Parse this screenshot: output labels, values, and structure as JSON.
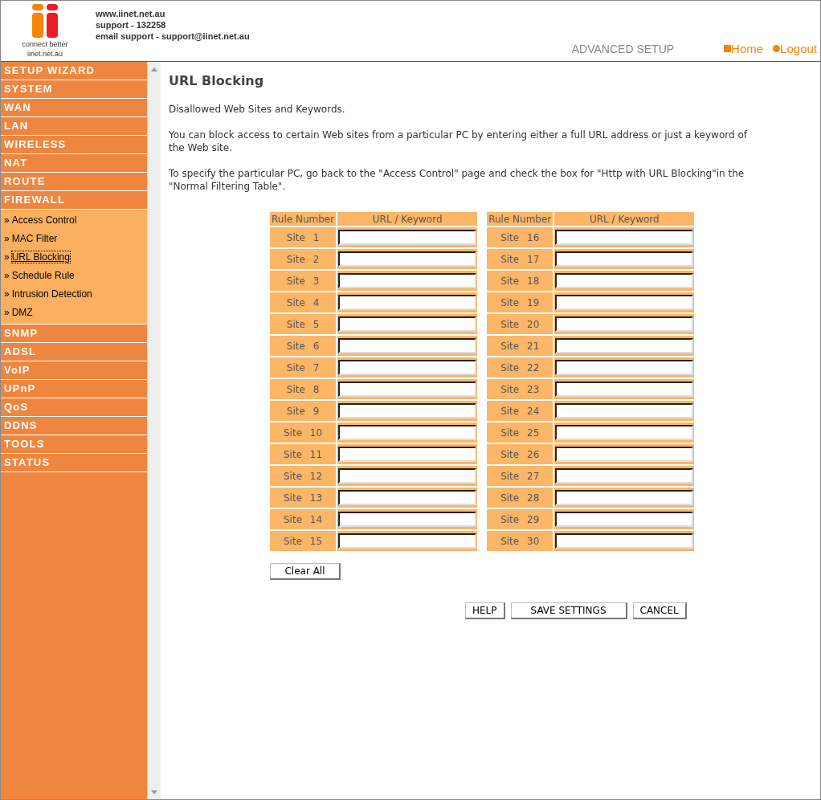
{
  "header": {
    "logo_tagline": "connect better",
    "logo_domain": "iinet.net.au",
    "contact_lines": [
      "www.iinet.net.au",
      "support - 132258",
      "email support - support@iinet.net.au"
    ],
    "section_title": "ADVANCED SETUP",
    "links": [
      {
        "label": "Home",
        "kind": "square"
      },
      {
        "label": "Logout",
        "kind": "dot"
      }
    ]
  },
  "sidebar": {
    "items": [
      {
        "label": "SETUP WIZARD"
      },
      {
        "label": "SYSTEM"
      },
      {
        "label": "WAN"
      },
      {
        "label": "LAN"
      },
      {
        "label": "WIRELESS"
      },
      {
        "label": "NAT"
      },
      {
        "label": "ROUTE"
      },
      {
        "label": "FIREWALL",
        "children": [
          {
            "bullet": "»",
            "label": "Access Control",
            "selected": false
          },
          {
            "bullet": "»",
            "label": "MAC Filter",
            "selected": false
          },
          {
            "bullet": "»",
            "label": "URL Blocking",
            "selected": true
          },
          {
            "bullet": "»",
            "label": "Schedule Rule",
            "selected": false
          },
          {
            "bullet": "»",
            "label": "Intrusion Detection",
            "selected": false
          },
          {
            "bullet": "»",
            "label": "DMZ",
            "selected": false
          }
        ]
      },
      {
        "label": "SNMP"
      },
      {
        "label": "ADSL"
      },
      {
        "label": "VoIP"
      },
      {
        "label": "UPnP"
      },
      {
        "label": "QoS"
      },
      {
        "label": "DDNS"
      },
      {
        "label": "TOOLS"
      },
      {
        "label": "STATUS"
      }
    ]
  },
  "page": {
    "title": "URL Blocking",
    "paragraphs": [
      "Disallowed Web Sites and Keywords.",
      "You can block access to certain Web sites from a particular PC by entering either a full URL address or just a keyword of the Web site.",
      "To specify the particular PC, go back to the \"Access Control\" page and check the box for \"Http with URL Blocking\"in the \"Normal Filtering Table\"."
    ]
  },
  "tables": [
    {
      "columns": [
        "Rule Number",
        "URL / Keyword"
      ],
      "rows": [
        "Site 1",
        "Site 2",
        "Site 3",
        "Site 4",
        "Site 5",
        "Site 6",
        "Site 7",
        "Site 8",
        "Site 9",
        "Site 10",
        "Site 11",
        "Site 12",
        "Site 13",
        "Site 14",
        "Site 15"
      ]
    },
    {
      "columns": [
        "Rule Number",
        "URL / Keyword"
      ],
      "rows": [
        "Site 16",
        "Site 17",
        "Site 18",
        "Site 19",
        "Site 20",
        "Site 21",
        "Site 22",
        "Site 23",
        "Site 24",
        "Site 25",
        "Site 26",
        "Site 27",
        "Site 28",
        "Site 29",
        "Site 30"
      ]
    }
  ],
  "clear_button": "Clear All",
  "buttons": [
    "HELP",
    "SAVE SETTINGS",
    "CANCEL"
  ]
}
